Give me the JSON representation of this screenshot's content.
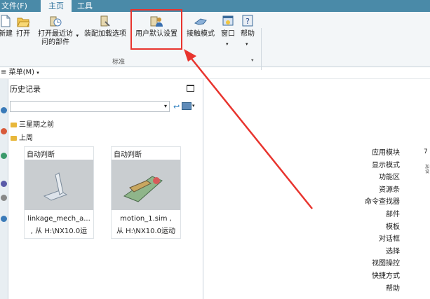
{
  "tabs": {
    "file": "文件(F)",
    "home": "主页",
    "tools": "工具"
  },
  "ribbon": {
    "buttons": {
      "new": "新建",
      "open": "打开",
      "open_recent_1": "打开最近访",
      "open_recent_2": "问的部件",
      "assembly_load": "装配加载选项",
      "user_defaults": "用户默认设置",
      "touch_mode": "接触模式",
      "window": "窗口",
      "help": "帮助"
    },
    "group_label": "标准"
  },
  "menubar": {
    "label": "菜单(M)"
  },
  "history": {
    "title": "历史记录",
    "tree": {
      "three_weeks": "三星期之前",
      "last_week": "上周"
    },
    "cards": [
      {
        "header": "自动判断",
        "line1": "linkage_mech_a...",
        "line2": ", 从 H:\\NX10.0运"
      },
      {
        "header": "自动判断",
        "line1": "motion_1.sim ,",
        "line2": "从 H:\\NX10.0运动"
      }
    ]
  },
  "right_list": [
    "应用模块",
    "显示模式",
    "功能区",
    "资源条",
    "命令查找器",
    "部件",
    "模板",
    "对话框",
    "选择",
    "视图操控",
    "快捷方式",
    "帮助"
  ],
  "right_edge": {
    "col_char": "7",
    "col_small": "加\n设"
  },
  "colors": {
    "titlebar": "#4a8aa8",
    "highlight": "#e8342e",
    "accent": "#2a6f9a"
  },
  "icons": {
    "new": "new-file-icon",
    "open": "open-folder-icon",
    "recent": "recent-parts-icon",
    "assembly": "assembly-load-icon",
    "user": "user-defaults-icon",
    "touch": "touch-mode-icon",
    "window": "window-icon",
    "help": "help-icon"
  }
}
